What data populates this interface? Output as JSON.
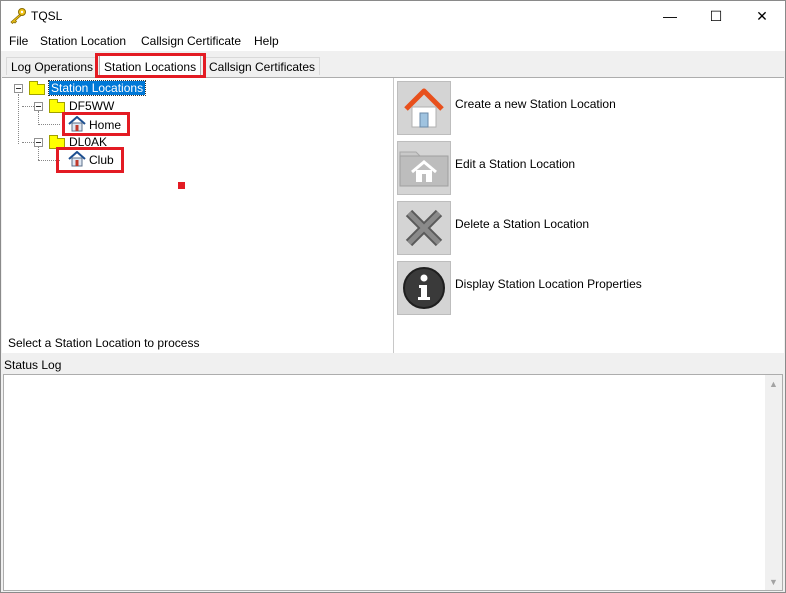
{
  "window": {
    "title": "TQSL",
    "controls": {
      "minimize": "—",
      "maximize": "☐",
      "close": "✕"
    }
  },
  "menu": [
    "File",
    "Station Location",
    "Callsign Certificate",
    "Help"
  ],
  "tabs": [
    {
      "label": "Log Operations",
      "active": false
    },
    {
      "label": "Station Locations",
      "active": true
    },
    {
      "label": "Callsign Certificates",
      "active": false
    }
  ],
  "tree": {
    "root": "Station Locations",
    "callsigns": [
      {
        "call": "DF5WW",
        "locations": [
          "Home"
        ]
      },
      {
        "call": "DL0AK",
        "locations": [
          "Club"
        ]
      }
    ]
  },
  "hint": "Select a Station Location to process",
  "actions": [
    {
      "label": "Create a new Station Location",
      "icon": "house-create-icon"
    },
    {
      "label": "Edit a Station Location",
      "icon": "folder-house-edit-icon"
    },
    {
      "label": "Delete a Station Location",
      "icon": "x-delete-icon"
    },
    {
      "label": "Display Station Location Properties",
      "icon": "info-icon"
    }
  ],
  "status": {
    "label": "Status Log",
    "scroll_up": "▲",
    "scroll_down": "▼"
  },
  "colors": {
    "highlight": "#e31b23",
    "selection": "#0078d7",
    "folder": "#ffff00"
  }
}
